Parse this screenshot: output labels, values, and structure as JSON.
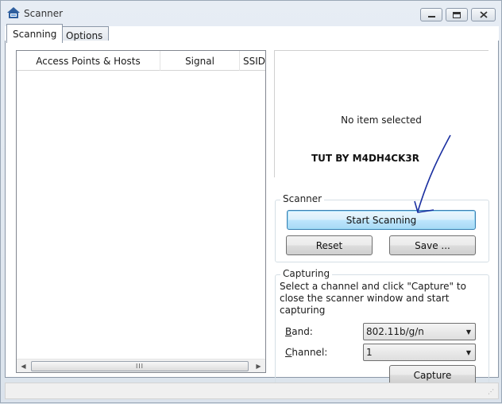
{
  "window": {
    "title": "Scanner"
  },
  "tabs": [
    {
      "label": "Scanning",
      "active": true
    },
    {
      "label": "Options",
      "active": false
    }
  ],
  "list": {
    "columns": [
      "Access Points & Hosts",
      "Signal",
      "SSID"
    ],
    "rows": [],
    "scroll_grip": "III"
  },
  "details": {
    "empty_text": "No item selected"
  },
  "annotation": {
    "text": "TUT BY M4DH4CK3R",
    "arrow_color": "#1a2fa0"
  },
  "scanner_group": {
    "title": "Scanner",
    "start_label": "Start Scanning",
    "reset_label": "Reset",
    "save_label": "Save ..."
  },
  "capture_group": {
    "title": "Capturing",
    "description": "Select a channel and click \"Capture\" to close the scanner window and start capturing",
    "band_label_access": "B",
    "band_label_rest": "and:",
    "band_value": "802.11b/g/n",
    "channel_label_access": "C",
    "channel_label_rest": "hannel:",
    "channel_value": "1",
    "capture_label": "Capture"
  },
  "colors": {
    "focus_border": "#3c7fb1",
    "window_bg": "#dfe6ee"
  }
}
